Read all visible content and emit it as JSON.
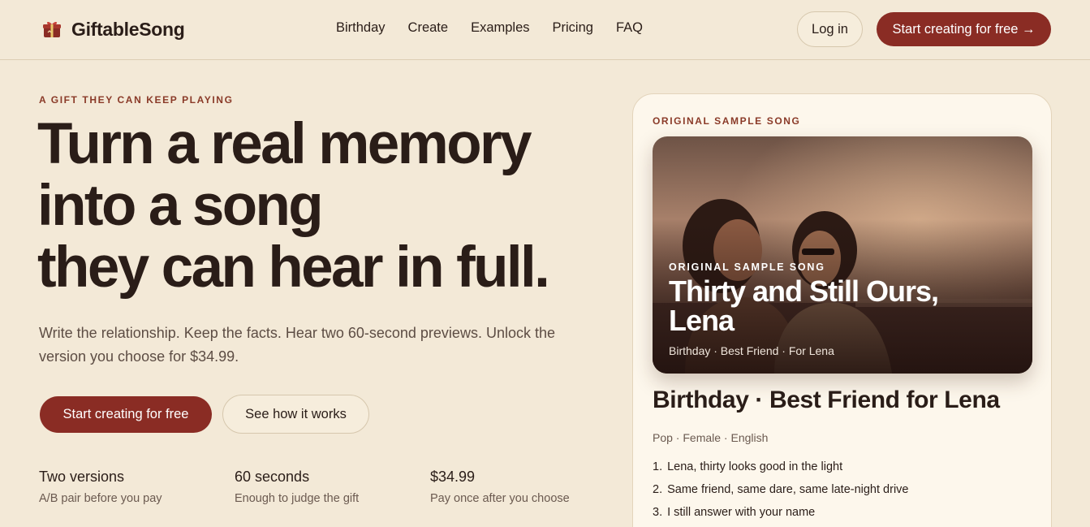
{
  "header": {
    "brand": "GiftableSong",
    "nav": [
      "Birthday",
      "Create",
      "Examples",
      "Pricing",
      "FAQ"
    ],
    "login_label": "Log in",
    "cta_label": "Start creating for free →"
  },
  "hero": {
    "eyebrow": "A GIFT THEY CAN KEEP PLAYING",
    "headline_lines": [
      "Turn a real memory",
      "into a song",
      "they can hear in full."
    ],
    "subtext": "Write the relationship. Keep the facts. Hear two 60-second previews. Unlock the version you choose for $34.99.",
    "primary_label": "Start creating for free",
    "secondary_label": "See how it works",
    "stats": [
      {
        "title": "Two versions",
        "sub": "A/B pair before you pay"
      },
      {
        "title": "60 seconds",
        "sub": "Enough to judge the gift"
      },
      {
        "title": "$34.99",
        "sub": "Pay once after you choose"
      }
    ]
  },
  "sample": {
    "eyebrow": "ORIGINAL SAMPLE SONG",
    "media_eyebrow": "ORIGINAL SAMPLE SONG",
    "media_title_line1": "Thirty and Still Ours,",
    "media_title_line2": "Lena",
    "media_tags": "Birthday · Best Friend · For Lena",
    "title": "Birthday · Best Friend for Lena",
    "meta": "Pop · Female · English",
    "lyrics": [
      {
        "num": "1.",
        "text": "Lena, thirty looks good in the light"
      },
      {
        "num": "2.",
        "text": "Same friend, same dare, same late-night drive"
      },
      {
        "num": "3.",
        "text": "I still answer with your name"
      }
    ]
  },
  "colors": {
    "background": "#f3e9d7",
    "accent": "#8a2c24",
    "eyebrow": "#8a3a28",
    "text": "#2a1d18"
  }
}
